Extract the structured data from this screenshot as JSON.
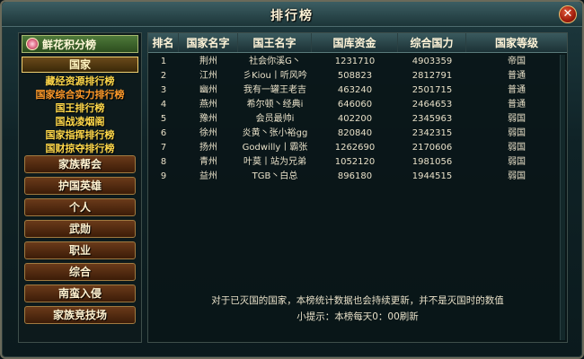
{
  "window": {
    "title": "排行榜"
  },
  "sidebar": {
    "score_button": "鲜花积分榜",
    "country_tab": "国家",
    "sub_items": [
      "藏经资源排行榜",
      "国家综合实力排行榜",
      "国王排行榜",
      "国战凌烟阁",
      "国家指挥排行榜",
      "国财掠夺排行榜",
      "灭城战英雄榜"
    ],
    "active_sub_index": 1,
    "menu_items": [
      "家族帮会",
      "护国英雄",
      "个人",
      "武勋",
      "职业",
      "综合",
      "南蛮入侵",
      "家族竞技场"
    ]
  },
  "table": {
    "headers": [
      "排名",
      "国家名字",
      "国王名字",
      "国库资金",
      "综合国力",
      "国家等级"
    ],
    "rows": [
      [
        "1",
        "荆州",
        "社会你溪G丶",
        "1231710",
        "4903359",
        "帝国"
      ],
      [
        "2",
        "江州",
        "彡Kiou丨听风吟",
        "508823",
        "2812791",
        "普通"
      ],
      [
        "3",
        "幽州",
        "我有一罐王老吉",
        "463240",
        "2501715",
        "普通"
      ],
      [
        "4",
        "燕州",
        "希尔顿丶经典i",
        "646060",
        "2464653",
        "普通"
      ],
      [
        "5",
        "豫州",
        "会员最帅i",
        "402200",
        "2345963",
        "弱国"
      ],
      [
        "6",
        "徐州",
        "炎黄丶张小裕gg",
        "820840",
        "2342315",
        "弱国"
      ],
      [
        "7",
        "扬州",
        "Godwilly丨霸张",
        "1262690",
        "2170606",
        "弱国"
      ],
      [
        "8",
        "青州",
        "叶莫丨站为兄弟",
        "1052120",
        "1981056",
        "弱国"
      ],
      [
        "9",
        "益州",
        "TGB丶白总",
        "896180",
        "1944515",
        "弱国"
      ]
    ]
  },
  "footer": {
    "note": "对于已灭国的国家，本榜统计数据也会持续更新，并不是灭国时的数值",
    "tip": "小提示：本榜每天0：00刷新"
  },
  "colors": {
    "sub_item": "#ffd84a",
    "sub_item_active": "#ff9a2a",
    "header_text": "#fff4d8"
  }
}
